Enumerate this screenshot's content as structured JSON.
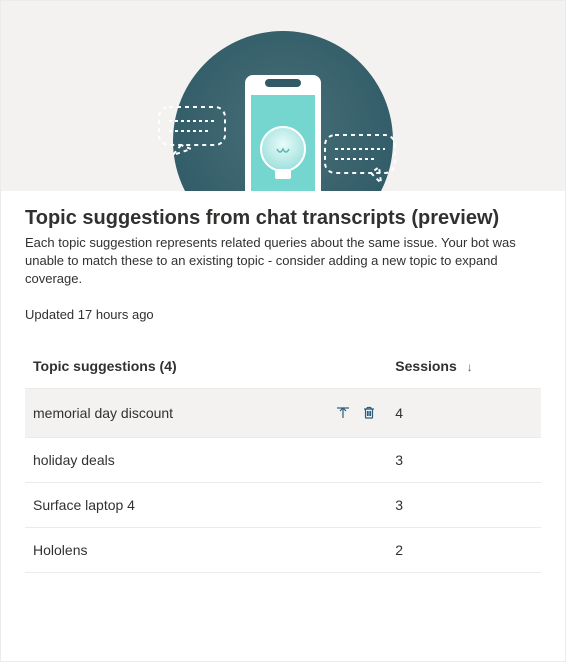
{
  "header": {
    "title": "Topic suggestions from chat transcripts (preview)",
    "description": "Each topic suggestion represents related queries about the same issue. Your bot was unable to match these to an existing topic - consider adding a new topic to expand coverage.",
    "updated": "Updated 17 hours ago"
  },
  "table": {
    "columns": {
      "name": "Topic suggestions (4)",
      "sessions": "Sessions"
    },
    "rows": [
      {
        "name": "memorial day discount",
        "sessions": "4",
        "hovered": true
      },
      {
        "name": "holiday deals",
        "sessions": "3",
        "hovered": false
      },
      {
        "name": "Surface laptop 4",
        "sessions": "3",
        "hovered": false
      },
      {
        "name": "Hololens",
        "sessions": "2",
        "hovered": false
      }
    ]
  },
  "icons": {
    "add": "add-topic-icon",
    "delete": "delete-icon",
    "sort": "↓"
  }
}
